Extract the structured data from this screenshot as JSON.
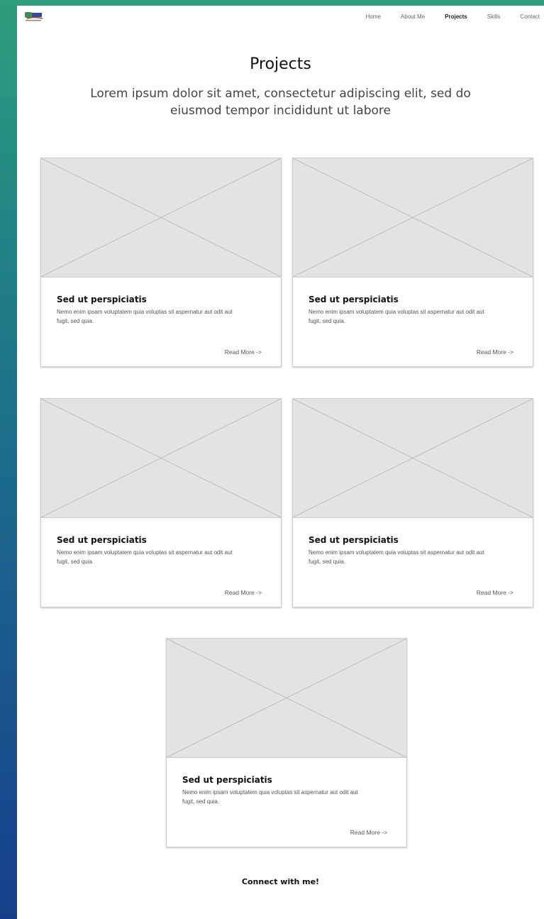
{
  "nav": {
    "items": [
      {
        "label": "Home",
        "active": false
      },
      {
        "label": "About Me",
        "active": false
      },
      {
        "label": "Projects",
        "active": true
      },
      {
        "label": "Skills",
        "active": false
      },
      {
        "label": "Contact",
        "active": false
      }
    ]
  },
  "header": {
    "title": "Projects",
    "subtitle": "Lorem ipsum dolor sit amet, consectetur adipiscing elit, sed do eiusmod tempor incididunt ut labore"
  },
  "projects": [
    {
      "title": "Sed ut perspiciatis",
      "description": "Nemo enim ipsam voluptatem quia voluptas sit aspernatur aut odit aut fugit, sed quia.",
      "link_label": "Read More ->"
    },
    {
      "title": "Sed ut perspiciatis",
      "description": "Nemo enim ipsam voluptatem quia voluptas sit aspernatur aut odit aut fugit, sed quia.",
      "link_label": "Read More ->"
    },
    {
      "title": "Sed ut perspiciatis",
      "description": "Nemo enim ipsam voluptatem quia voluptas sit aspernatur aut odit aut fugit, sed quia.",
      "link_label": "Read More ->"
    },
    {
      "title": "Sed ut perspiciatis",
      "description": "Nemo enim ipsam voluptatem quia voluptas sit aspernatur aut odit aut fugit, sed quia.",
      "link_label": "Read More ->"
    },
    {
      "title": "Sed ut perspiciatis",
      "description": "Nemo enim ipsam voluptatem quia voluptas sit aspernatur aut odit aut fugit, sed quia.",
      "link_label": "Read More ->"
    }
  ],
  "footer": {
    "connect_label": "Connect with me!"
  },
  "colors": {
    "background_gradient_top": "#2e9e7c",
    "background_gradient_bottom": "#153f8a",
    "placeholder_fill": "#e3e3e3"
  }
}
